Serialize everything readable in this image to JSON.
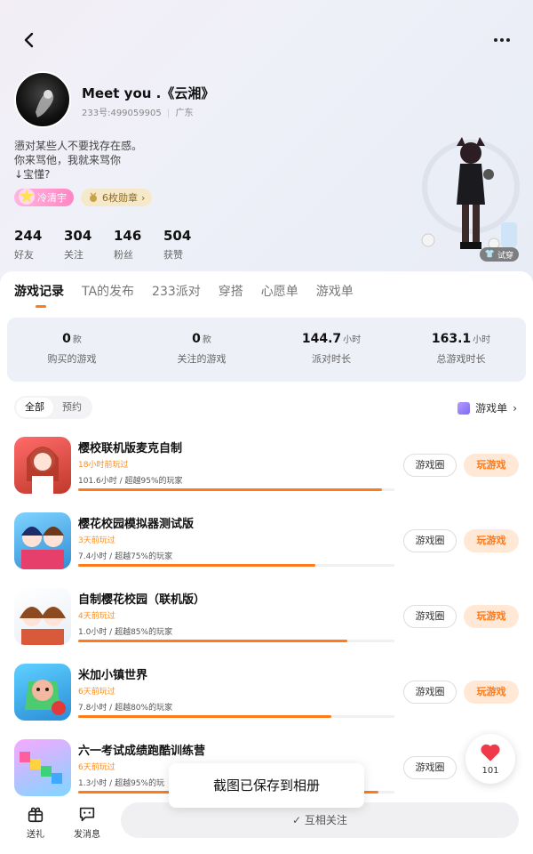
{
  "header": {
    "nickname": "Meet you .《云湘》",
    "user_id_text": "233号:499059905",
    "region": "广东",
    "bio_lines": [
      "懑对某些人不要找存在感。",
      "你来骂他，我就来骂你",
      "↓宝懂?"
    ],
    "vip_label": "冷清宇",
    "medals_label": "6枚勋章",
    "try_on_label": "试穿"
  },
  "stats": [
    {
      "num": "244",
      "label": "好友"
    },
    {
      "num": "304",
      "label": "关注"
    },
    {
      "num": "146",
      "label": "粉丝"
    },
    {
      "num": "504",
      "label": "获赞"
    }
  ],
  "tabs": [
    {
      "label": "游戏记录",
      "active": true
    },
    {
      "label": "TA的发布"
    },
    {
      "label": "233派对"
    },
    {
      "label": "穿搭"
    },
    {
      "label": "心愿单"
    },
    {
      "label": "游戏单"
    }
  ],
  "summary": [
    {
      "value": "0",
      "unit": "款",
      "label": "购买的游戏"
    },
    {
      "value": "0",
      "unit": "款",
      "label": "关注的游戏"
    },
    {
      "value": "144.7",
      "unit": "小时",
      "label": "派对时长"
    },
    {
      "value": "163.1",
      "unit": "小时",
      "label": "总游戏时长"
    }
  ],
  "filter": {
    "all": "全部",
    "reserve": "预约"
  },
  "game_list_link": "游戏单",
  "games": [
    {
      "name": "樱校联机版麦克自制",
      "recent": "18小时前玩过",
      "time": "101.6小时 / 超越95%的玩家",
      "progress": 0.96,
      "circle_label": "游戏圈",
      "play_label": "玩游戏"
    },
    {
      "name": "樱花校园模拟器测试版",
      "recent": "3天前玩过",
      "time": "7.4小时 / 超越75%的玩家",
      "progress": 0.75,
      "circle_label": "游戏圈",
      "play_label": "玩游戏"
    },
    {
      "name": "自制樱花校园（联机版）",
      "recent": "4天前玩过",
      "time": "1.0小时 / 超越85%的玩家",
      "progress": 0.85,
      "circle_label": "游戏圈",
      "play_label": "玩游戏"
    },
    {
      "name": "米加小镇世界",
      "recent": "6天前玩过",
      "time": "7.8小时 / 超越80%的玩家",
      "progress": 0.8,
      "circle_label": "游戏圈",
      "play_label": "玩游戏"
    },
    {
      "name": "六一考试成绩跑酷训练营",
      "recent": "6天前玩过",
      "time": "1.3小时 / 超越95%的玩",
      "progress": 0.95,
      "circle_label": "游戏圈",
      "play_label": ""
    }
  ],
  "toast": "截图已保存到相册",
  "like_count": "101",
  "bottom": {
    "gift_label": "送礼",
    "message_label": "发消息",
    "follow_label": "互相关注"
  }
}
